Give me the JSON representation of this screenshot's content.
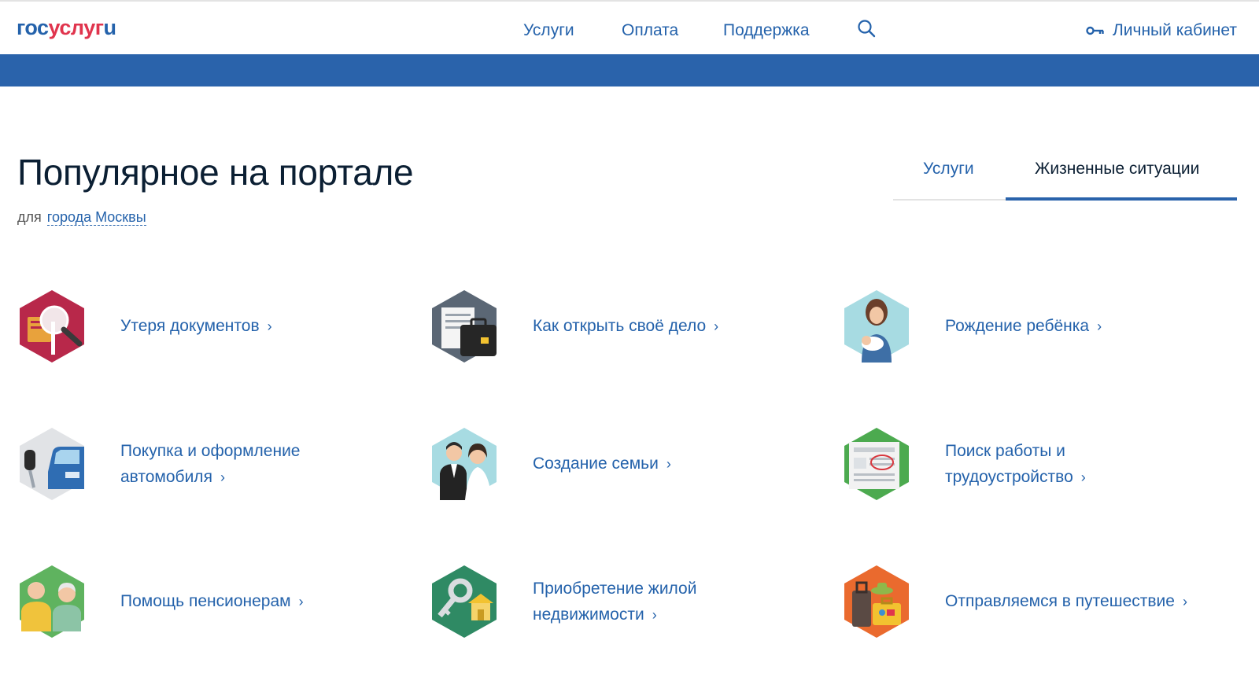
{
  "header": {
    "logo": {
      "part1": "гос",
      "part2": "услуг",
      "part3": "u"
    },
    "nav": [
      {
        "label": "Услуги"
      },
      {
        "label": "Оплата"
      },
      {
        "label": "Поддержка"
      }
    ],
    "search_icon": "search-icon",
    "cabinet_label": "Личный кабинет",
    "cabinet_icon": "key-icon"
  },
  "colors": {
    "brand_blue": "#2a63ab",
    "link_blue": "#2462ab",
    "logo_red": "#e0344d",
    "text_dark": "#0b1f33"
  },
  "main": {
    "title": "Популярное на портале",
    "subtitle_prefix": "для",
    "city_link": "города Москвы",
    "tabs": [
      {
        "label": "Услуги",
        "active": false
      },
      {
        "label": "Жизненные ситуации",
        "active": true
      }
    ],
    "situations": [
      {
        "line1": "Утеря документов",
        "line2": "",
        "icon": "lost-documents-icon"
      },
      {
        "line1": "Как открыть своё дело",
        "line2": "",
        "icon": "business-briefcase-icon"
      },
      {
        "line1": "Рождение ребёнка",
        "line2": "",
        "icon": "mother-baby-icon"
      },
      {
        "line1": "Покупка и оформление",
        "line2": "автомобиля",
        "icon": "car-key-icon"
      },
      {
        "line1": "Создание семьи",
        "line2": "",
        "icon": "wedding-couple-icon"
      },
      {
        "line1": "Поиск работы и",
        "line2": "трудоустройство",
        "icon": "job-newspaper-icon"
      },
      {
        "line1": "Помощь пенсионерам",
        "line2": "",
        "icon": "pensioners-icon"
      },
      {
        "line1": "Приобретение жилой",
        "line2": "недвижимости",
        "icon": "house-key-icon"
      },
      {
        "line1": "Отправляемся в путешествие",
        "line2": "",
        "icon": "travel-luggage-icon"
      }
    ],
    "chevron": "›"
  }
}
